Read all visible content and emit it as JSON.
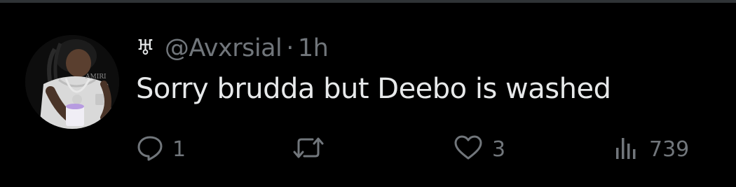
{
  "tweet": {
    "display_name_glyph": "♅",
    "handle": "@Avxrsial",
    "separator": "·",
    "time": "1h",
    "text": "Sorry brudda but Deebo is washed"
  },
  "actions": {
    "reply": {
      "icon": "reply-icon",
      "count": "1"
    },
    "retweet": {
      "icon": "retweet-icon",
      "count": ""
    },
    "like": {
      "icon": "heart-icon",
      "count": "3"
    },
    "views": {
      "icon": "views-icon",
      "count": "739"
    }
  },
  "colors": {
    "background": "#000000",
    "primary_text": "#e7e9ea",
    "secondary_text": "#71767b",
    "divider": "#2f3336"
  }
}
